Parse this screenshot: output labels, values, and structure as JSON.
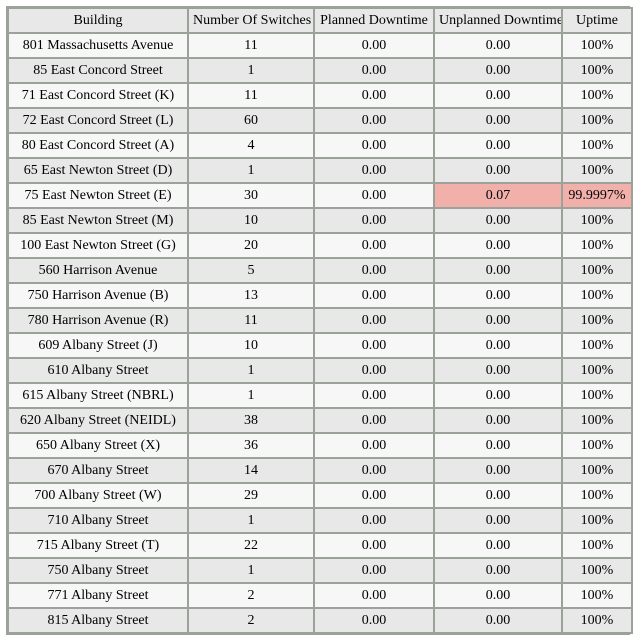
{
  "columns": [
    "Building",
    "Number Of Switches",
    "Planned Downtime",
    "Unplanned Downtime",
    "Uptime"
  ],
  "flag_color": "#f2b0ab",
  "rows": [
    {
      "building": "801 Massachusetts Avenue",
      "switches": "11",
      "planned": "0.00",
      "unplanned": "0.00",
      "uptime": "100%",
      "flag": false
    },
    {
      "building": "85 East Concord Street",
      "switches": "1",
      "planned": "0.00",
      "unplanned": "0.00",
      "uptime": "100%",
      "flag": false
    },
    {
      "building": "71 East Concord Street (K)",
      "switches": "11",
      "planned": "0.00",
      "unplanned": "0.00",
      "uptime": "100%",
      "flag": false
    },
    {
      "building": "72 East Concord Street (L)",
      "switches": "60",
      "planned": "0.00",
      "unplanned": "0.00",
      "uptime": "100%",
      "flag": false
    },
    {
      "building": "80 East Concord Street (A)",
      "switches": "4",
      "planned": "0.00",
      "unplanned": "0.00",
      "uptime": "100%",
      "flag": false
    },
    {
      "building": "65 East Newton Street (D)",
      "switches": "1",
      "planned": "0.00",
      "unplanned": "0.00",
      "uptime": "100%",
      "flag": false
    },
    {
      "building": "75 East Newton Street (E)",
      "switches": "30",
      "planned": "0.00",
      "unplanned": "0.07",
      "uptime": "99.9997%",
      "flag": true
    },
    {
      "building": "85 East Newton Street (M)",
      "switches": "10",
      "planned": "0.00",
      "unplanned": "0.00",
      "uptime": "100%",
      "flag": false
    },
    {
      "building": "100 East Newton Street (G)",
      "switches": "20",
      "planned": "0.00",
      "unplanned": "0.00",
      "uptime": "100%",
      "flag": false
    },
    {
      "building": "560 Harrison Avenue",
      "switches": "5",
      "planned": "0.00",
      "unplanned": "0.00",
      "uptime": "100%",
      "flag": false
    },
    {
      "building": "750 Harrison Avenue (B)",
      "switches": "13",
      "planned": "0.00",
      "unplanned": "0.00",
      "uptime": "100%",
      "flag": false
    },
    {
      "building": "780 Harrison Avenue (R)",
      "switches": "11",
      "planned": "0.00",
      "unplanned": "0.00",
      "uptime": "100%",
      "flag": false
    },
    {
      "building": "609 Albany Street (J)",
      "switches": "10",
      "planned": "0.00",
      "unplanned": "0.00",
      "uptime": "100%",
      "flag": false
    },
    {
      "building": "610 Albany Street",
      "switches": "1",
      "planned": "0.00",
      "unplanned": "0.00",
      "uptime": "100%",
      "flag": false
    },
    {
      "building": "615 Albany Street (NBRL)",
      "switches": "1",
      "planned": "0.00",
      "unplanned": "0.00",
      "uptime": "100%",
      "flag": false
    },
    {
      "building": "620 Albany Street (NEIDL)",
      "switches": "38",
      "planned": "0.00",
      "unplanned": "0.00",
      "uptime": "100%",
      "flag": false
    },
    {
      "building": "650 Albany Street (X)",
      "switches": "36",
      "planned": "0.00",
      "unplanned": "0.00",
      "uptime": "100%",
      "flag": false
    },
    {
      "building": "670 Albany Street",
      "switches": "14",
      "planned": "0.00",
      "unplanned": "0.00",
      "uptime": "100%",
      "flag": false
    },
    {
      "building": "700 Albany Street (W)",
      "switches": "29",
      "planned": "0.00",
      "unplanned": "0.00",
      "uptime": "100%",
      "flag": false
    },
    {
      "building": "710 Albany Street",
      "switches": "1",
      "planned": "0.00",
      "unplanned": "0.00",
      "uptime": "100%",
      "flag": false
    },
    {
      "building": "715 Albany Street (T)",
      "switches": "22",
      "planned": "0.00",
      "unplanned": "0.00",
      "uptime": "100%",
      "flag": false
    },
    {
      "building": "750 Albany Street",
      "switches": "1",
      "planned": "0.00",
      "unplanned": "0.00",
      "uptime": "100%",
      "flag": false
    },
    {
      "building": "771 Albany Street",
      "switches": "2",
      "planned": "0.00",
      "unplanned": "0.00",
      "uptime": "100%",
      "flag": false
    },
    {
      "building": "815 Albany Street",
      "switches": "2",
      "planned": "0.00",
      "unplanned": "0.00",
      "uptime": "100%",
      "flag": false
    }
  ]
}
